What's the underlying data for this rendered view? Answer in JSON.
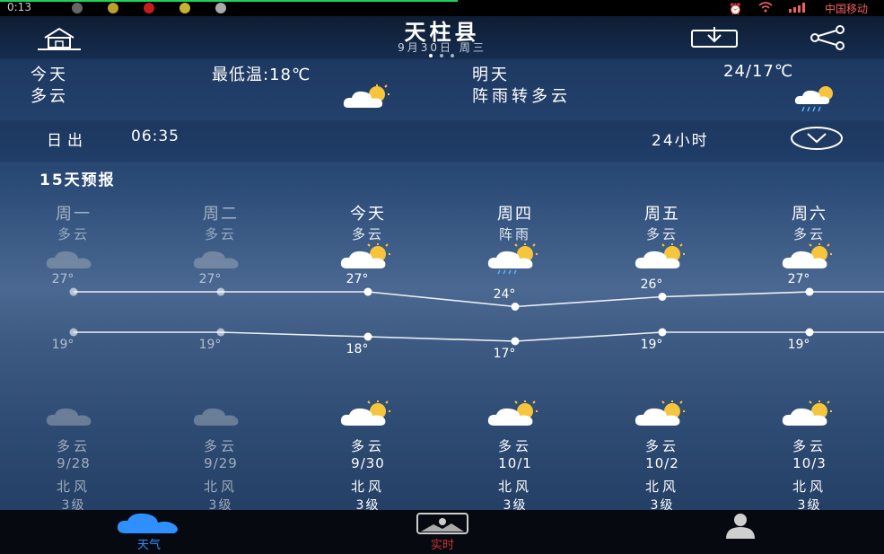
{
  "status_bar": {
    "time": "0:13",
    "carrier": "中国移动"
  },
  "header": {
    "title": "天柱县",
    "date": "9月30日  周三"
  },
  "today": {
    "label": "今天",
    "min_temp": "最低温:18℃",
    "condition": "多云",
    "tomorrow_label": "明天",
    "tomorrow_temp": "24/17℃",
    "tomorrow_condition": "阵雨转多云"
  },
  "sun": {
    "label": "日出",
    "time": "06:35",
    "hourly_label": "24小时"
  },
  "forecast": {
    "title": "15天预报",
    "days": [
      {
        "weekday": "周一",
        "day_cond": "多云",
        "high": "27°",
        "low": "19°",
        "night_cond": "多云",
        "date": "9/28",
        "wind_dir": "北风",
        "wind_level": "3级",
        "past": true,
        "icon": "cloudy"
      },
      {
        "weekday": "周二",
        "day_cond": "多云",
        "high": "27°",
        "low": "19°",
        "night_cond": "多云",
        "date": "9/29",
        "wind_dir": "北风",
        "wind_level": "3级",
        "past": true,
        "icon": "cloudy"
      },
      {
        "weekday": "今天",
        "day_cond": "多云",
        "high": "27°",
        "low": "18°",
        "night_cond": "多云",
        "date": "9/30",
        "wind_dir": "北风",
        "wind_level": "3级",
        "past": false,
        "icon": "partly-cloudy"
      },
      {
        "weekday": "周四",
        "day_cond": "阵雨",
        "high": "24°",
        "low": "17°",
        "night_cond": "多云",
        "date": "10/1",
        "wind_dir": "北风",
        "wind_level": "3级",
        "past": false,
        "icon": "shower"
      },
      {
        "weekday": "周五",
        "day_cond": "多云",
        "high": "26°",
        "low": "19°",
        "night_cond": "多云",
        "date": "10/2",
        "wind_dir": "北风",
        "wind_level": "3级",
        "past": false,
        "icon": "partly-cloudy"
      },
      {
        "weekday": "周六",
        "day_cond": "多云",
        "high": "27°",
        "low": "19°",
        "night_cond": "多云",
        "date": "10/3",
        "wind_dir": "北风",
        "wind_level": "3级",
        "past": false,
        "icon": "partly-cloudy"
      }
    ],
    "high_values": [
      27,
      27,
      27,
      24,
      26,
      27
    ],
    "low_values": [
      19,
      19,
      18,
      17,
      19,
      19
    ]
  },
  "tabs": [
    {
      "label": "天气",
      "icon": "cloud-icon",
      "active": true
    },
    {
      "label": "实时",
      "icon": "photo-icon",
      "active": false
    },
    {
      "label": "",
      "icon": "user-icon",
      "active": false
    }
  ],
  "colors": {
    "active_tab": "#2f8fff",
    "sun": "#f7c53b",
    "line": "#ffffff"
  }
}
